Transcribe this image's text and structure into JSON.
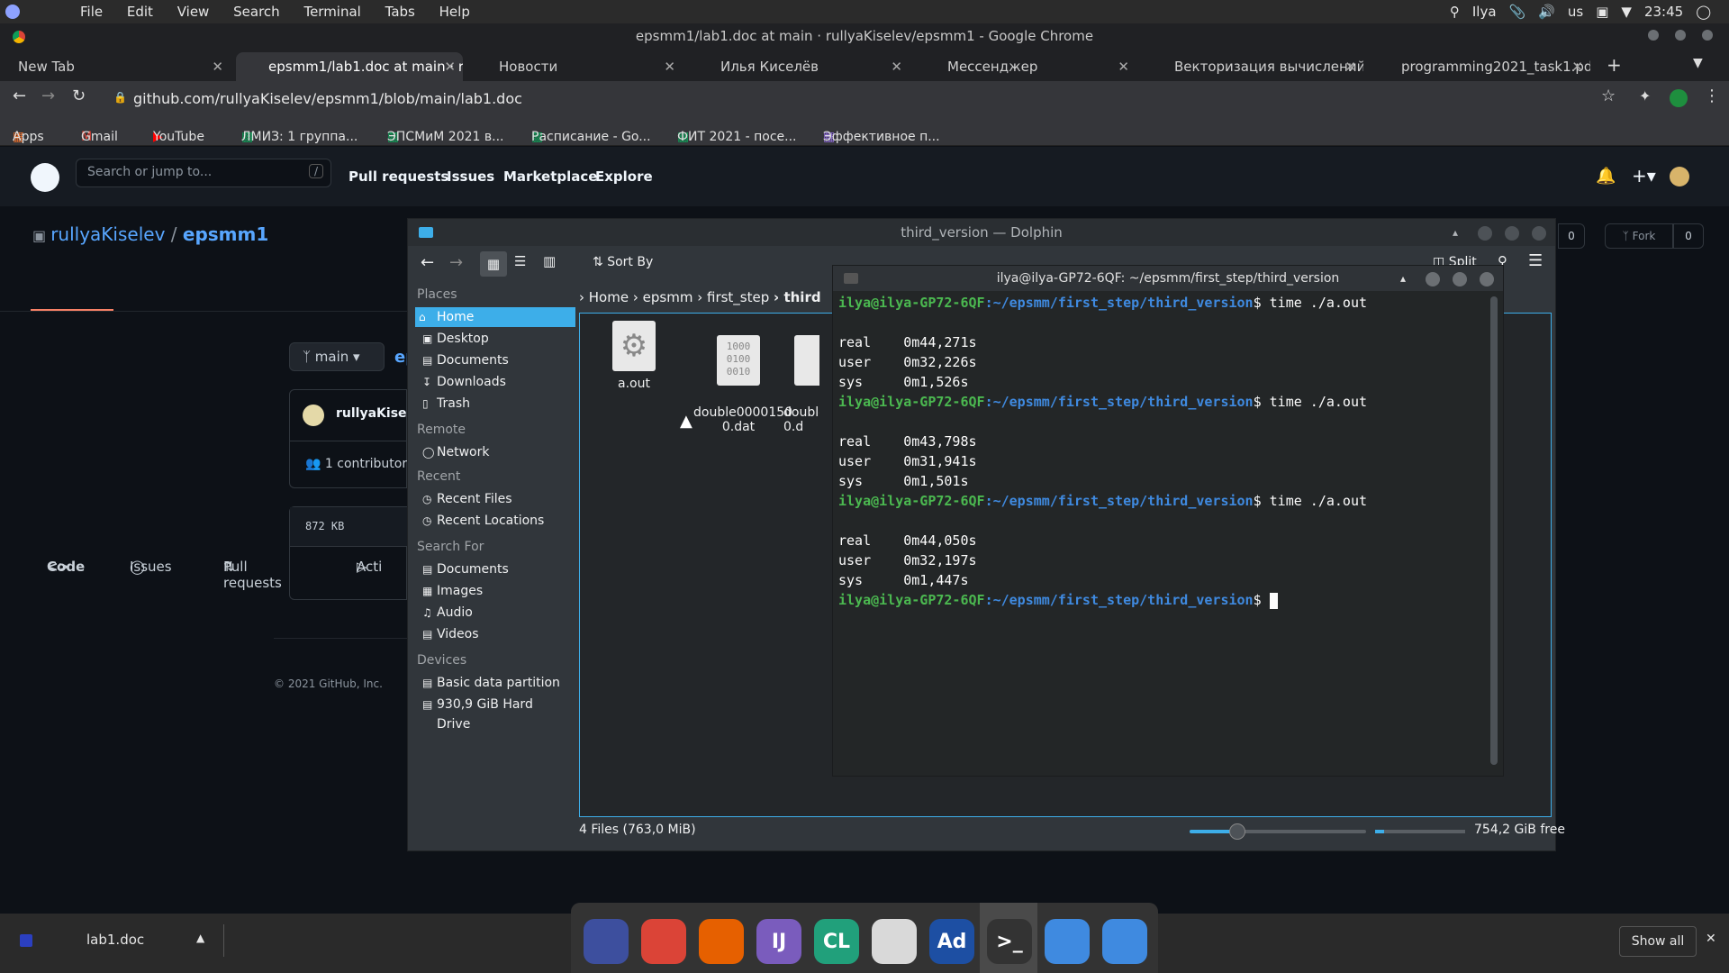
{
  "system": {
    "menu": [
      "File",
      "Edit",
      "View",
      "Search",
      "Terminal",
      "Tabs",
      "Help"
    ],
    "user": "Ilya",
    "keyboard": "us",
    "clock": "23:45"
  },
  "browser": {
    "window_title": "epsmm1/lab1.doc at main · rullyaKiselev/epsmm1 - Google Chrome",
    "tabs": [
      {
        "label": "New Tab"
      },
      {
        "label": "epsmm1/lab1.doc at main · r"
      },
      {
        "label": "Новости"
      },
      {
        "label": "Илья Киселёв"
      },
      {
        "label": "Мессенджер"
      },
      {
        "label": "Векторизация вычислений"
      },
      {
        "label": "programming2021_task1.pdf"
      }
    ],
    "url": "github.com/rullyaKiselev/epsmm1/blob/main/lab1.doc",
    "bookmarks": [
      "Apps",
      "Gmail",
      "YouTube",
      "ЛМИЗ: 1 группа...",
      "ЭПСМиМ 2021 в...",
      "Расписание - Go...",
      "ФИТ 2021 - посе...",
      "Эффективное п..."
    ]
  },
  "github": {
    "search_placeholder": "Search or jump to...",
    "search_key": "/",
    "nav": [
      "Pull requests",
      "Issues",
      "Marketplace",
      "Explore"
    ],
    "owner": "rullyaKiselev",
    "separator": "/",
    "repo": "epsmm1",
    "tabs": [
      "Code",
      "Issues",
      "Pull requests",
      "Acti"
    ],
    "branch": "main",
    "author": "rullyaKisele",
    "contributors": "1 contributor",
    "file_size": "872 KB",
    "footer": "© 2021 GitHub, Inc.",
    "watch_count": "0",
    "fork_label": "Fork",
    "fork_count": "0",
    "path_partial": "ep"
  },
  "dolphin": {
    "title": "third_version — Dolphin",
    "sort_label": "Sort By",
    "split_label": "Split",
    "places": {
      "places_heading": "Places",
      "places_items": [
        "Home",
        "Desktop",
        "Documents",
        "Downloads",
        "Trash"
      ],
      "remote_heading": "Remote",
      "remote_items": [
        "Network"
      ],
      "recent_heading": "Recent",
      "recent_items": [
        "Recent Files",
        "Recent Locations"
      ],
      "search_heading": "Search For",
      "search_items": [
        "Documents",
        "Images",
        "Audio",
        "Videos"
      ],
      "devices_heading": "Devices",
      "devices_items": [
        "Basic data partition",
        "930,9 GiB Hard Drive"
      ]
    },
    "breadcrumb": [
      "Home",
      "epsmm",
      "first_step",
      "third"
    ],
    "files": [
      {
        "name": "a.out"
      },
      {
        "name": "double0000150\n0.dat"
      },
      {
        "name": "double\n0.d"
      }
    ],
    "status": "4 Files (763,0 MiB)",
    "free_space": "754,2 GiB free",
    "zoom_fraction": 0.27,
    "space_used_fraction": 0.1
  },
  "terminal": {
    "title": "ilya@ilya-GP72-6QF: ~/epsmm/first_step/third_version",
    "user_host": "ilya@ilya-GP72-6QF",
    "path": ":~/epsmm/first_step/third_version",
    "command": "$ time ./a.out",
    "prompt_end": "$ ",
    "runs": [
      {
        "real": "real\t0m44,271s",
        "user": "user\t0m32,226s",
        "sys": "sys\t0m1,526s"
      },
      {
        "real": "real\t0m43,798s",
        "user": "user\t0m31,941s",
        "sys": "sys\t0m1,501s"
      },
      {
        "real": "real\t0m44,050s",
        "user": "user\t0m32,197s",
        "sys": "sys\t0m1,447s"
      }
    ]
  },
  "downloads": {
    "file": "lab1.doc",
    "show_all": "Show all"
  },
  "dock": [
    {
      "name": "monitor-app-icon",
      "color": "#3d4f9e"
    },
    {
      "name": "chrome-icon",
      "color": "#db4437"
    },
    {
      "name": "firefox-icon",
      "color": "#e66000"
    },
    {
      "name": "intellij-icon",
      "color": "#7a5cbd",
      "label": "IJ"
    },
    {
      "name": "clion-icon",
      "color": "#21a07b",
      "label": "CL"
    },
    {
      "name": "xournal-icon",
      "color": "#d9d9d9"
    },
    {
      "name": "adobe-icon",
      "color": "#1d4fa3",
      "label": "Ad"
    },
    {
      "name": "terminal-icon",
      "color": "#333333",
      "label": ">_"
    },
    {
      "name": "files-icon",
      "color": "#3f8ae0"
    },
    {
      "name": "apps-grid-icon",
      "color": "#3f8ae0"
    }
  ]
}
